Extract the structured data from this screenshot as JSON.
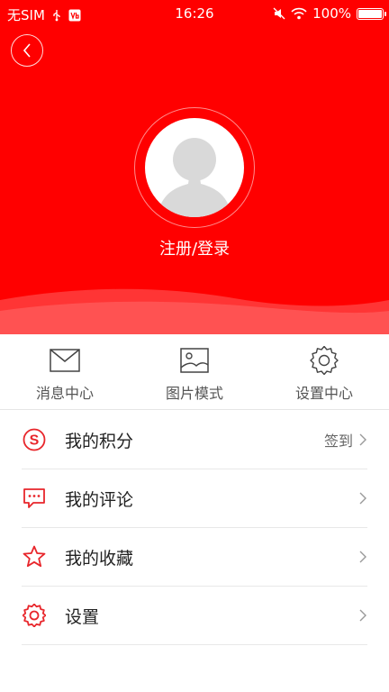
{
  "status_bar": {
    "carrier": "无SIM",
    "time": "16:26",
    "battery": "100%",
    "icons": [
      "usb-icon",
      "vb-badge-icon",
      "mute-icon",
      "wifi-icon",
      "battery-icon"
    ]
  },
  "header": {
    "back_icon": "chevron-left-icon",
    "avatar_icon": "default-avatar-icon",
    "login_label": "注册/登录"
  },
  "quick_nav": [
    {
      "label": "消息中心",
      "icon": "envelope-icon"
    },
    {
      "label": "图片模式",
      "icon": "image-icon"
    },
    {
      "label": "设置中心",
      "icon": "gear-icon"
    }
  ],
  "menu": [
    {
      "label": "我的积分",
      "icon": "points-icon",
      "extra": "签到"
    },
    {
      "label": "我的评论",
      "icon": "comment-icon",
      "extra": ""
    },
    {
      "label": "我的收藏",
      "icon": "star-icon",
      "extra": ""
    },
    {
      "label": "设置",
      "icon": "settings-icon",
      "extra": ""
    }
  ],
  "colors": {
    "header_red": "#ff0000",
    "icon_red": "#e8262b",
    "text_dark": "#222222",
    "text_gray": "#555555"
  }
}
